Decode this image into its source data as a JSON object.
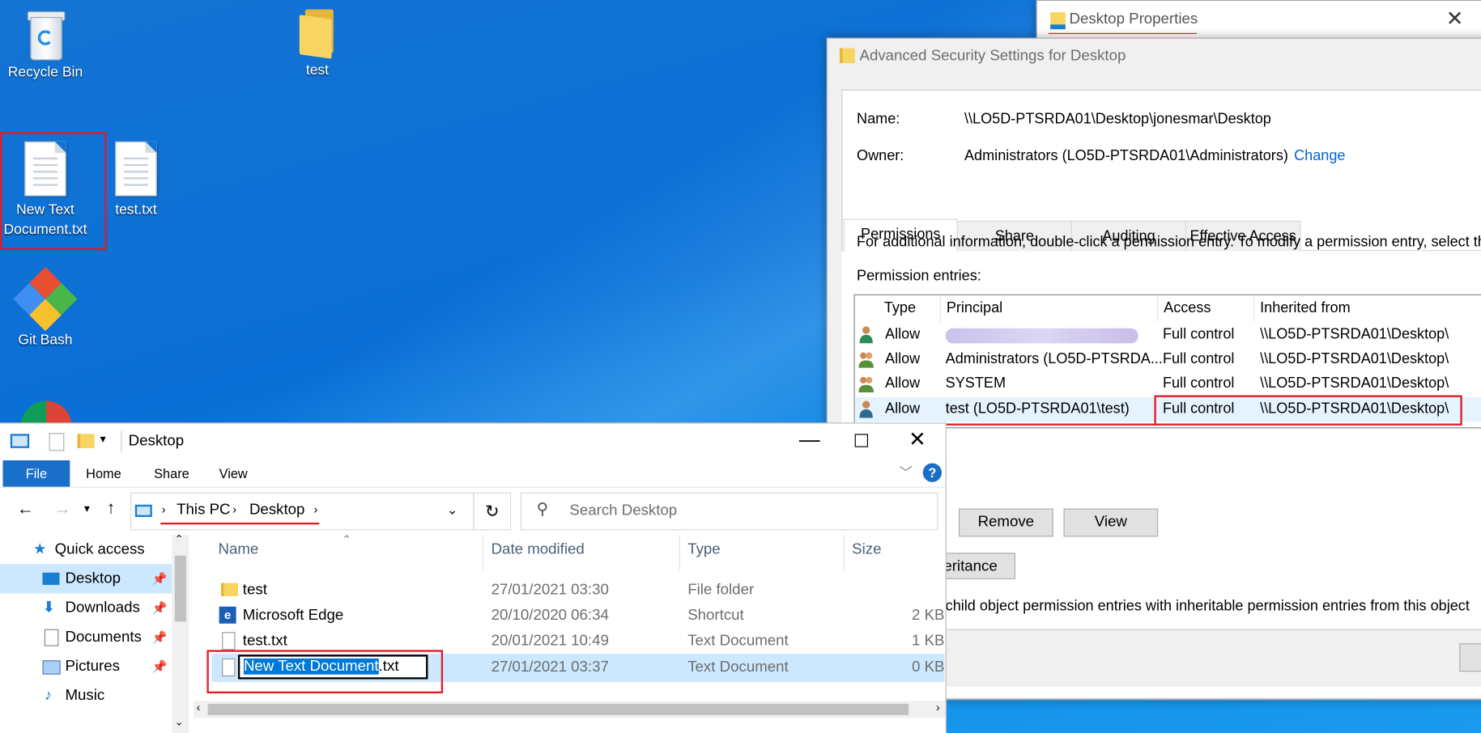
{
  "desktop": {
    "icons": [
      {
        "label": "Recycle Bin"
      },
      {
        "label": "test"
      },
      {
        "label": "New Text Document.txt"
      },
      {
        "label": "test.txt"
      },
      {
        "label": "Git Bash"
      }
    ]
  },
  "properties_window": {
    "title": "Desktop Properties"
  },
  "security_window": {
    "title": "Advanced Security Settings for Desktop",
    "name_label": "Name:",
    "name_value": "\\\\LO5D-PTSRDA01\\Desktop\\jonesmar\\Desktop",
    "owner_label": "Owner:",
    "owner_value": "Administrators (LO5D-PTSRDA01\\Administrators)",
    "change_link": "Change",
    "tabs": [
      "Permissions",
      "Share",
      "Auditing",
      "Effective Access"
    ],
    "info_text": "For additional information, double-click a permission entry. To modify a permission entry, select th",
    "entries_label": "Permission entries:",
    "columns": [
      "Type",
      "Principal",
      "Access",
      "Inherited from"
    ],
    "rows": [
      {
        "type": "Allow",
        "principal": "",
        "access": "Full control",
        "inherited": "\\\\LO5D-PTSRDA01\\Desktop\\"
      },
      {
        "type": "Allow",
        "principal": "Administrators (LO5D-PTSRDA...",
        "access": "Full control",
        "inherited": "\\\\LO5D-PTSRDA01\\Desktop\\"
      },
      {
        "type": "Allow",
        "principal": "SYSTEM",
        "access": "Full control",
        "inherited": "\\\\LO5D-PTSRDA01\\Desktop\\"
      },
      {
        "type": "Allow",
        "principal": "test (LO5D-PTSRDA01\\test)",
        "access": "Full control",
        "inherited": "\\\\LO5D-PTSRDA01\\Desktop\\"
      }
    ],
    "remove_button": "Remove",
    "view_button": "View",
    "inheritance_button": "eritance",
    "replace_text": "child object permission entries with inheritable permission entries from this object"
  },
  "explorer": {
    "title": "Desktop",
    "ribbon": {
      "file": "File",
      "home": "Home",
      "share": "Share",
      "view": "View",
      "help": "?"
    },
    "breadcrumb": [
      "This PC",
      "Desktop"
    ],
    "search_placeholder": "Search Desktop",
    "nav": [
      {
        "label": "Quick access"
      },
      {
        "label": "Desktop"
      },
      {
        "label": "Downloads"
      },
      {
        "label": "Documents"
      },
      {
        "label": "Pictures"
      },
      {
        "label": "Music"
      }
    ],
    "columns": {
      "name": "Name",
      "date": "Date modified",
      "type": "Type",
      "size": "Size"
    },
    "files": [
      {
        "name": "test",
        "date": "27/01/2021 03:30",
        "type": "File folder",
        "size": ""
      },
      {
        "name": "Microsoft Edge",
        "date": "20/10/2020 06:34",
        "type": "Shortcut",
        "size": "2 KB"
      },
      {
        "name": "test.txt",
        "date": "20/01/2021 10:49",
        "type": "Text Document",
        "size": "1 KB"
      },
      {
        "name": "New Text Document.txt",
        "date": "27/01/2021 03:37",
        "type": "Text Document",
        "size": "0 KB"
      }
    ],
    "rename": {
      "selected": "New Text Document",
      "rest": ".txt"
    }
  },
  "colors": {
    "accent": "#0078d7",
    "highlight_red": "#e21b24",
    "selection": "#cce8ff",
    "desktop_blue": "#0a6fd6"
  }
}
